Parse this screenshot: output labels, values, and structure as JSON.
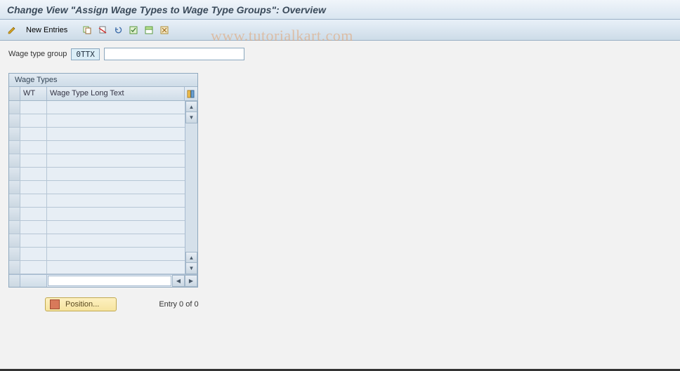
{
  "header": {
    "title": "Change View \"Assign Wage Types to Wage Type Groups\": Overview"
  },
  "toolbar": {
    "new_entries_label": "New Entries"
  },
  "field": {
    "label": "Wage type group",
    "value": "0TTX",
    "desc": ""
  },
  "table": {
    "title": "Wage Types",
    "col_wt": "WT",
    "col_txt": "Wage Type Long Text",
    "rows": []
  },
  "footer": {
    "position_label": "Position...",
    "entry_text": "Entry 0 of 0"
  },
  "watermark": "www.tutorialkart.com"
}
